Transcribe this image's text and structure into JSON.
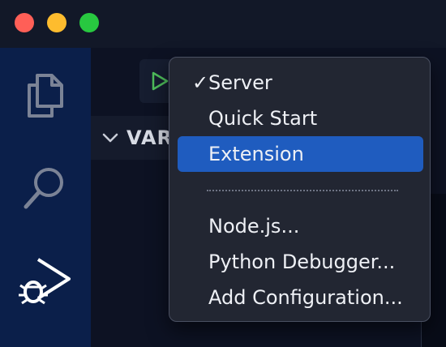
{
  "window": {
    "controls": [
      {
        "name": "close",
        "color": "#ff5f57"
      },
      {
        "name": "minimize",
        "color": "#febc2e"
      },
      {
        "name": "maximize",
        "color": "#28c840"
      }
    ]
  },
  "activity_bar": {
    "items": [
      {
        "name": "explorer",
        "icon": "files-icon"
      },
      {
        "name": "search",
        "icon": "search-icon"
      },
      {
        "name": "run-and-debug",
        "icon": "run-debug-icon"
      }
    ]
  },
  "sidebar": {
    "section_title": "VAR"
  },
  "dropdown": {
    "items": [
      {
        "label": "Server",
        "checked": true,
        "selected": false
      },
      {
        "label": "Quick Start",
        "checked": false,
        "selected": false
      },
      {
        "label": "Extension",
        "checked": false,
        "selected": true
      },
      {
        "label": "Node.js...",
        "checked": false,
        "selected": false
      },
      {
        "label": "Python Debugger...",
        "checked": false,
        "selected": false
      },
      {
        "label": "Add Configuration...",
        "checked": false,
        "selected": false
      }
    ],
    "checkmark": "✓",
    "accent_color": "#1f5cbf"
  }
}
